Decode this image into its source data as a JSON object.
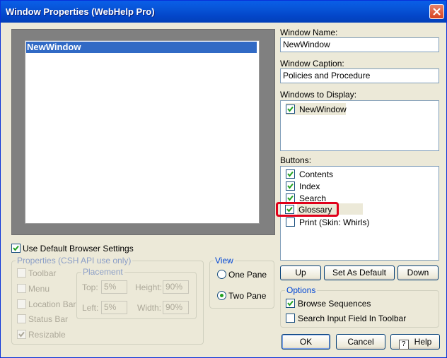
{
  "window": {
    "title": "Window Properties (WebHelp Pro)"
  },
  "preview": {
    "selected_item": "NewWindow"
  },
  "fields": {
    "window_name_label": "Window Name:",
    "window_name_value": "NewWindow",
    "window_caption_label": "Window Caption:",
    "window_caption_value": "Policies and Procedure",
    "windows_to_display_label": "Windows to Display:",
    "windows_to_display": [
      {
        "label": "NewWindow",
        "checked": true
      }
    ]
  },
  "buttons_section": {
    "label": "Buttons:",
    "items": [
      {
        "label": "Contents",
        "checked": true
      },
      {
        "label": "Index",
        "checked": true
      },
      {
        "label": "Search",
        "checked": true
      },
      {
        "label": "Glossary",
        "checked": true
      },
      {
        "label": "Print (Skin: Whirls)",
        "checked": false
      }
    ],
    "up": "Up",
    "set_default": "Set As Default",
    "down": "Down"
  },
  "browser": {
    "use_default_label": "Use Default Browser Settings",
    "use_default_checked": true,
    "properties_label": "Properties (CSH API use only)",
    "toolbar": "Toolbar",
    "menu": "Menu",
    "location_bar": "Location Bar",
    "status_bar": "Status Bar",
    "resizable": "Resizable",
    "placement_label": "Placement",
    "top_label": "Top:",
    "top_value": "5%",
    "height_label": "Height:",
    "height_value": "90%",
    "left_label": "Left:",
    "left_value": "5%",
    "width_label": "Width:",
    "width_value": "90%"
  },
  "view": {
    "label": "View",
    "one_pane": "One Pane",
    "two_pane": "Two Pane",
    "selected": "Two Pane"
  },
  "options": {
    "label": "Options",
    "browse_sequences": "Browse Sequences",
    "browse_sequences_checked": true,
    "search_input": "Search Input Field In Toolbar",
    "search_input_checked": false
  },
  "dialog_buttons": {
    "ok": "OK",
    "cancel": "Cancel",
    "help": "Help"
  },
  "colors": {
    "title_bar": "#0753d6",
    "selection": "#316ac5",
    "highlight_box": "#e0001a"
  }
}
